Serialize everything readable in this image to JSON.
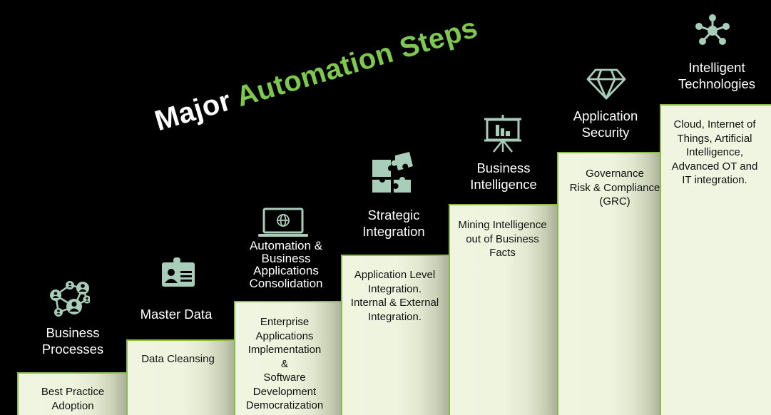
{
  "title": {
    "word1": "Major",
    "word2": "Automation Steps",
    "colors": {
      "word1": "#ffffff",
      "word2": "#7ec850"
    }
  },
  "palette": {
    "background": "#000000",
    "box_fill": "#f0f5e1",
    "box_border": "#8db84a",
    "icon_color": "#a8cdb8",
    "heading_color": "#ffffff",
    "body_text": "#111111"
  },
  "steps": [
    {
      "order": 1,
      "icon": "network-people-icon",
      "heading": "Business\nProcesses",
      "description": "Best Practice\nAdoption"
    },
    {
      "order": 2,
      "icon": "id-badge-icon",
      "heading": "Master Data",
      "description": "Data Cleansing"
    },
    {
      "order": 3,
      "icon": "laptop-globe-icon",
      "heading": "Automation &\nBusiness\nApplications\nConsolidation",
      "description": "Enterprise\nApplications\nImplementation\n&\nSoftware\nDevelopment\nDemocratization"
    },
    {
      "order": 4,
      "icon": "puzzle-icon",
      "heading": "Strategic\nIntegration",
      "description": "Application Level\nIntegration.\nInternal & External\nIntegration."
    },
    {
      "order": 5,
      "icon": "presentation-chart-icon",
      "heading": "Business\nIntelligence",
      "description": "Mining Intelligence\nout of Business\nFacts"
    },
    {
      "order": 6,
      "icon": "diamond-icon",
      "heading": "Application\nSecurity",
      "description": "Governance\nRisk & Compliance\n(GRC)"
    },
    {
      "order": 7,
      "icon": "hub-network-icon",
      "heading": "Intelligent\nTechnologies",
      "description": "Cloud, Internet of\nThings, Artificial\nIntelligence,\nAdvanced OT and\nIT integration."
    }
  ]
}
